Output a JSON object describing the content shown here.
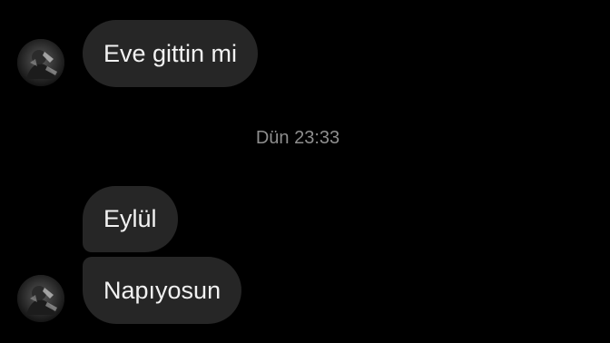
{
  "conversation": {
    "messages": [
      {
        "text": "Eve gittin mi",
        "sender": "contact"
      },
      {
        "text": "Eylül",
        "sender": "contact"
      },
      {
        "text": "Napıyosun",
        "sender": "contact"
      }
    ],
    "timestamp": "Dün 23:33"
  },
  "colors": {
    "background": "#000000",
    "bubble": "#262626",
    "bubble_text": "#f2f2f2",
    "timestamp_text": "#8e8e8e"
  },
  "icons": {
    "avatar": "contact-avatar"
  }
}
